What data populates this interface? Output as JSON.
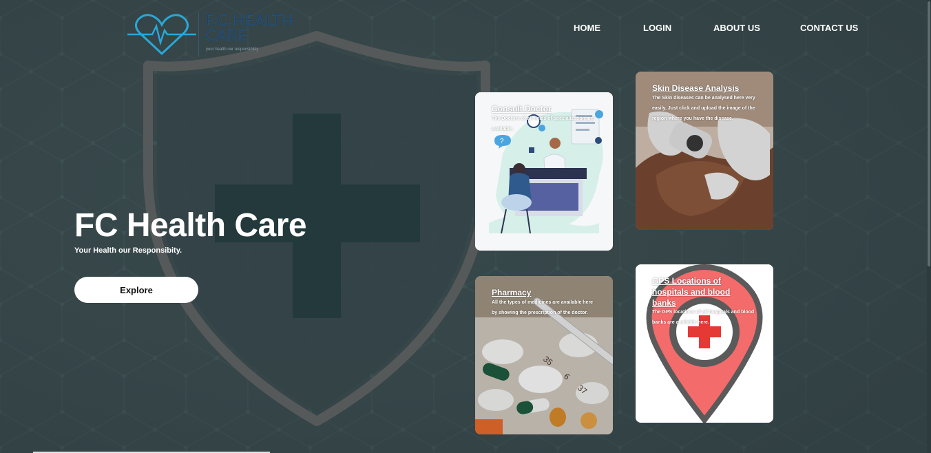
{
  "colors": {
    "background": "#37474a",
    "accent": "#29a8d6",
    "pin_red": "#f46b6b"
  },
  "logo": {
    "icon": "heart-pulse-icon",
    "title": "F.C.HEALTH CARE",
    "tagline": "your health our responsibility"
  },
  "nav": {
    "home": "HOME",
    "login": "LOGIN",
    "about": "ABOUT US",
    "contact": "CONTACT US"
  },
  "hero": {
    "title": "FC Health Care",
    "subtitle": "Your Health our Responsibity.",
    "button": "Explore"
  },
  "cards": {
    "consult": {
      "title": "Consult Doctor",
      "desc": "The Doctors of all fields of specialization are available."
    },
    "skin": {
      "title": "Skin Disease Analysis",
      "desc": "The Skin diseases can be analysed here very easily. Just click and upload the image of the region where you have the disease."
    },
    "pharmacy": {
      "title": "Pharmacy",
      "desc": "All the types of medicines are available here by showing the prescription of the doctor."
    },
    "gps": {
      "title": "GPS Locations of hospitals and blood banks",
      "desc": "The GPS locations of all hospitals and blood banks are available here."
    }
  }
}
